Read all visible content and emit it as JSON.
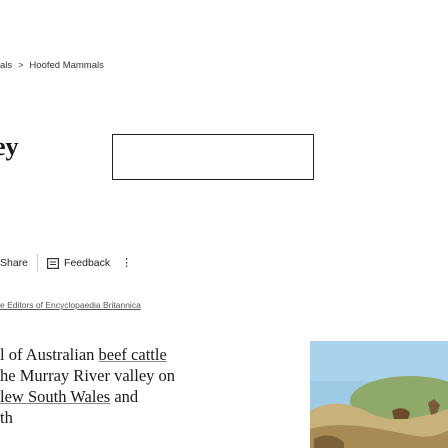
{
  "breadcrumb": {
    "parent": "als",
    "separator": ">",
    "current": "Hoofed Mammals"
  },
  "article": {
    "title": "ey"
  },
  "actions": {
    "share_label": "Share",
    "feedback_label": "Feedback",
    "more_icon": "more-vertical-icon",
    "feedback_icon": "feedback-icon"
  },
  "byline": "e Editors of Encyclopaedia Britannica",
  "paragraph": {
    "line1_prefix": "l of Australian ",
    "line1_link": "beef cattle",
    "line2": "he Murray River valley on",
    "line3_link": "lew South Wales",
    "line3_suffix": " and",
    "line4": "th"
  },
  "colors": {
    "text": "#1a1a1a",
    "muted": "#555555",
    "divider": "#cccccc",
    "photo_sky": "#9ecae6"
  }
}
